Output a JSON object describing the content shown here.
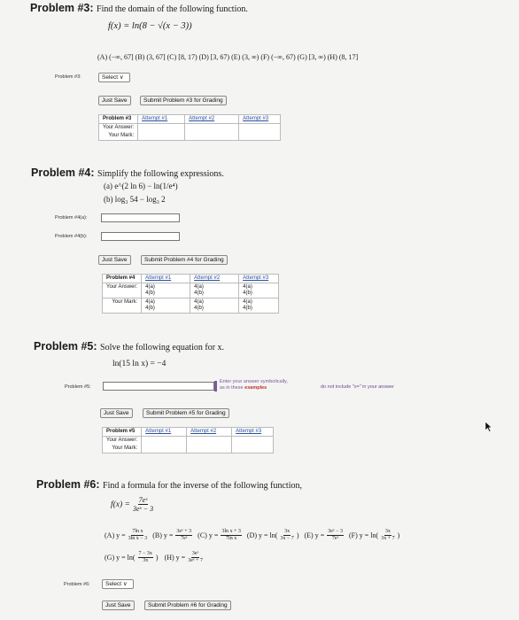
{
  "problem3": {
    "title": "Problem #3:",
    "prompt": "Find the domain of the following function.",
    "function": "f(x) = ln(8 − √(x − 3))",
    "choices": "(A) (−∞, 67]   (B) (3, 67]   (C) [8, 17)   (D) [3, 67)   (E) (3, ∞)   (F) (−∞, 67)   (G) [3, ∞)   (H) (8, 17]",
    "row_label": "Problem #3:",
    "select_value": "Select",
    "just_save": "Just Save",
    "submit": "Submit Problem #3 for Grading",
    "table": {
      "header": [
        "Problem #3",
        "Attempt #1",
        "Attempt #2",
        "Attempt #3"
      ],
      "row1": "Your Answer:",
      "row2": "Your Mark:"
    }
  },
  "problem4": {
    "title": "Problem #4:",
    "prompt": "Simplify the following expressions.",
    "part_a": "(a) e^(2 ln 6) − ln(1/e⁴)",
    "part_b": "(b) log₃ 54 − log₃ 2",
    "row_label_a": "Problem #4(a):",
    "row_label_b": "Problem #4(b):",
    "just_save": "Just Save",
    "submit": "Submit Problem #4 for Grading",
    "table": {
      "header": [
        "Problem #4",
        "Attempt #1",
        "Attempt #2",
        "Attempt #3"
      ],
      "row1": "Your Answer:",
      "row2": "Your Mark:",
      "cell_a": "4(a)",
      "cell_b": "4(b)"
    }
  },
  "problem5": {
    "title": "Problem #5:",
    "prompt": "Solve the following equation for x.",
    "equation": "ln(15 ln x) = −4",
    "row_label": "Problem #5:",
    "hint_line1": "Enter your answer symbolically,",
    "hint_line2_pre": "as in these ",
    "hint_line2_link": "examples",
    "hint_right": "do not include \"x=\" in your answer",
    "just_save": "Just Save",
    "submit": "Submit Problem #5 for Grading",
    "table": {
      "header": [
        "Problem #5",
        "Attempt #1",
        "Attempt #2",
        "Attempt #3"
      ],
      "row1": "Your Answer:",
      "row2": "Your Mark:"
    }
  },
  "problem6": {
    "title": "Problem #6:",
    "prompt": "Find a formula for the inverse of the following function,",
    "fx_lhs": "f(x) =",
    "fx_num": "7eˣ",
    "fx_den": "3eˣ − 3",
    "choices_row1": {
      "A_label": "(A) y =",
      "A_num": "7ln x",
      "A_den": "3ln x − 3",
      "B_label": "(B) y =",
      "B_num": "3eˣ + 3",
      "B_den": "7eˣ",
      "C_label": "(C) y =",
      "C_num": "3ln x + 3",
      "C_den": "7ln x",
      "D_label": "(D) y = ln(",
      "D_num": "3x",
      "D_den": "3x − 7",
      "D_close": ")",
      "E_label": "(E) y =",
      "E_num": "3eˣ − 3",
      "E_den": "7eˣ",
      "F_label": "(F) y = ln(",
      "F_num": "3x",
      "F_den": "3x + 7",
      "F_close": ")"
    },
    "choices_row2": {
      "G_label": "(G) y = ln(",
      "G_num": "7 − 3x",
      "G_den": "3x",
      "G_close": ")",
      "H_label": "(H) y =",
      "H_num": "3eˣ",
      "H_den": "3eˣ + 7"
    },
    "row_label": "Problem #6:",
    "select_value": "Select",
    "just_save": "Just Save",
    "submit": "Submit Problem #6 for Grading"
  }
}
